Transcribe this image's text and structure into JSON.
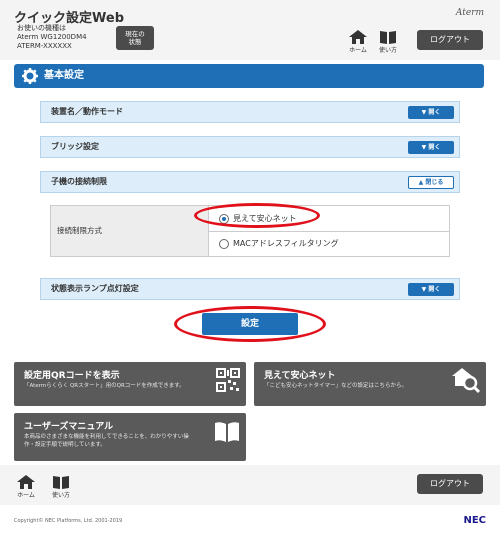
{
  "header": {
    "app_title": "クイック設定Web",
    "model_lines": [
      "お使いの機種は",
      "Aterm WG1200DM4",
      "ATERM-XXXXXX"
    ],
    "status_button_lines": [
      "現在の",
      "状態"
    ],
    "brand": "Aterm",
    "home_label": "ホーム",
    "manual_label": "使い方",
    "logout_label": "ログアウト"
  },
  "section": {
    "title": "基本設定"
  },
  "panels": [
    {
      "label": "装置名／動作モード",
      "toggle": "開く"
    },
    {
      "label": "ブリッジ設定",
      "toggle": "開く"
    },
    {
      "label": "子機の接続制限",
      "toggle": "閉じる"
    },
    {
      "label": "状態表示ランプ点灯設定",
      "toggle": "開く"
    }
  ],
  "restriction": {
    "label": "接続制限方式",
    "options": [
      {
        "label": "見えて安心ネット",
        "selected": true
      },
      {
        "label": "MACアドレスフィルタリング",
        "selected": false
      }
    ]
  },
  "settings_button": "設定",
  "cards": [
    {
      "title": "設定用QRコードを表示",
      "desc": "「Atermらくらく QRスタート」用のQRコードを作成できます。",
      "icon": "qr-code-icon"
    },
    {
      "title": "見えて安心ネット",
      "desc": "「こども安心ネットタイマー」などの設定はこちらから。",
      "icon": "home-search-icon"
    },
    {
      "title": "ユーザーズマニュアル",
      "desc_lines": [
        "本商品のさまざまな機能を利用してできることを、わかりやすい操",
        "作・設定手順で説明しています。"
      ],
      "icon": "book-icon"
    }
  ],
  "footer": {
    "home_label": "ホーム",
    "manual_label": "使い方",
    "logout_label": "ログアウト",
    "copyright": "Copyright© NEC Platforms, Ltd. 2001-2019",
    "brand": "NEC"
  },
  "colors": {
    "accent": "#1f6fb7",
    "panel_bg": "#ddeefa",
    "card_bg": "#5a5a5a",
    "annotation": "#e0111b"
  }
}
